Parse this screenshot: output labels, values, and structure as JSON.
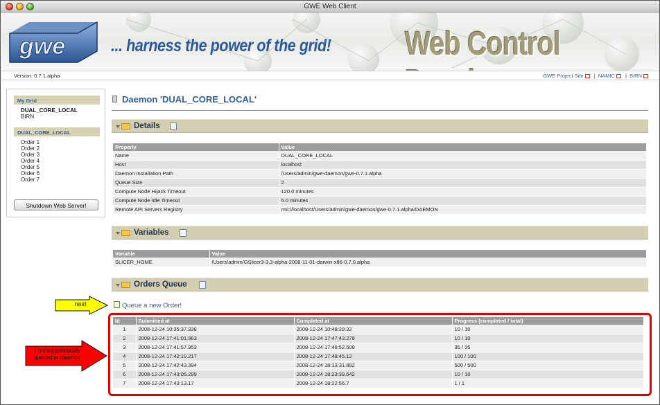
{
  "window": {
    "title": "GWE Web Client"
  },
  "banner": {
    "logo_text": "gwe",
    "tagline": "... harness the power of the grid!",
    "heading": "Web Control Panel"
  },
  "infobar": {
    "version": "Version: 0.7.1.alpha",
    "links": [
      "GWE Project Site",
      "NAMIC",
      "BIRN"
    ],
    "separator": "|"
  },
  "sidebar": {
    "my_grid_label": "My Grid",
    "grid_items": [
      "DUAL_CORE_LOCAL",
      "BIRN"
    ],
    "daemon_label": "DUAL_CORE_LOCAL",
    "orders": [
      "Order 1",
      "Order 2",
      "Order 3",
      "Order 4",
      "Order 5",
      "Order 6",
      "Order 7"
    ],
    "shutdown_button": "Shutdown Web Server!"
  },
  "main": {
    "title": "Daemon 'DUAL_CORE_LOCAL'",
    "details": {
      "heading": "Details",
      "columns": [
        "Property",
        "Value"
      ],
      "rows": [
        [
          "Name",
          "DUAL_CORE_LOCAL"
        ],
        [
          "Host",
          "localhost"
        ],
        [
          "Daemon Installation Path",
          "/Users/admin/gwe-daemon/gwe-0.7.1.alpha"
        ],
        [
          "Queue Size",
          "2"
        ],
        [
          "Compute Node Hijack Timeout",
          "120.0 minutes"
        ],
        [
          "Compute Node Idle Timeout",
          "5.0 minutes"
        ],
        [
          "Remote API Servers Registry",
          "rmi://localhost/Users/admin/gwe-daemon/gwe-0.7.1.alpha/DAEMON"
        ]
      ]
    },
    "variables": {
      "heading": "Variables",
      "columns": [
        "Variable",
        "Value"
      ],
      "rows": [
        [
          "SLICER_HOME",
          "/Users/admin/GSlicer3-3.3-alpha-2008-11-01-darwin-x86-0.7.0.alpha"
        ]
      ]
    },
    "orders_queue": {
      "heading": "Orders Queue",
      "queue_link": "Queue a new Order!",
      "columns": [
        "Id",
        "Submitted at",
        "Completed at",
        "Progress (completed / total)"
      ],
      "rows": [
        [
          "1",
          "2008-12-24 10:35:37.338",
          "2008-12-24 10:48:29.32",
          "10 / 10"
        ],
        [
          "2",
          "2008-12-24 17:41:01.963",
          "2008-12-24 17:47:43.278",
          "10 / 10"
        ],
        [
          "3",
          "2008-12-24 17:41:57.953",
          "2008-12-24 17:46:52.508",
          "35 / 35"
        ],
        [
          "4",
          "2008-12-24 17:42:19.217",
          "2008-12-24 17:48:45.12",
          "100 / 100"
        ],
        [
          "5",
          "2008-12-24 17:42:43.394",
          "2008-12-24 18:13:31.892",
          "500 / 500"
        ],
        [
          "6",
          "2008-12-24 17:43:05.299",
          "2008-12-24 18:23:39.642",
          "10 / 10"
        ],
        [
          "7",
          "2008-12-24 17:43:13.17",
          "2008-12-24 18:22:56.7",
          "1 / 1"
        ]
      ]
    }
  },
  "annotations": {
    "next_label": "next",
    "orders_label": "7 orders previously queued in daemon"
  },
  "colors": {
    "link_blue": "#2e5e9a",
    "section_tan": "#d3cdb1",
    "highlight_red": "#e00000",
    "callout_yellow": "#ffff00",
    "callout_red": "#ff0000"
  }
}
